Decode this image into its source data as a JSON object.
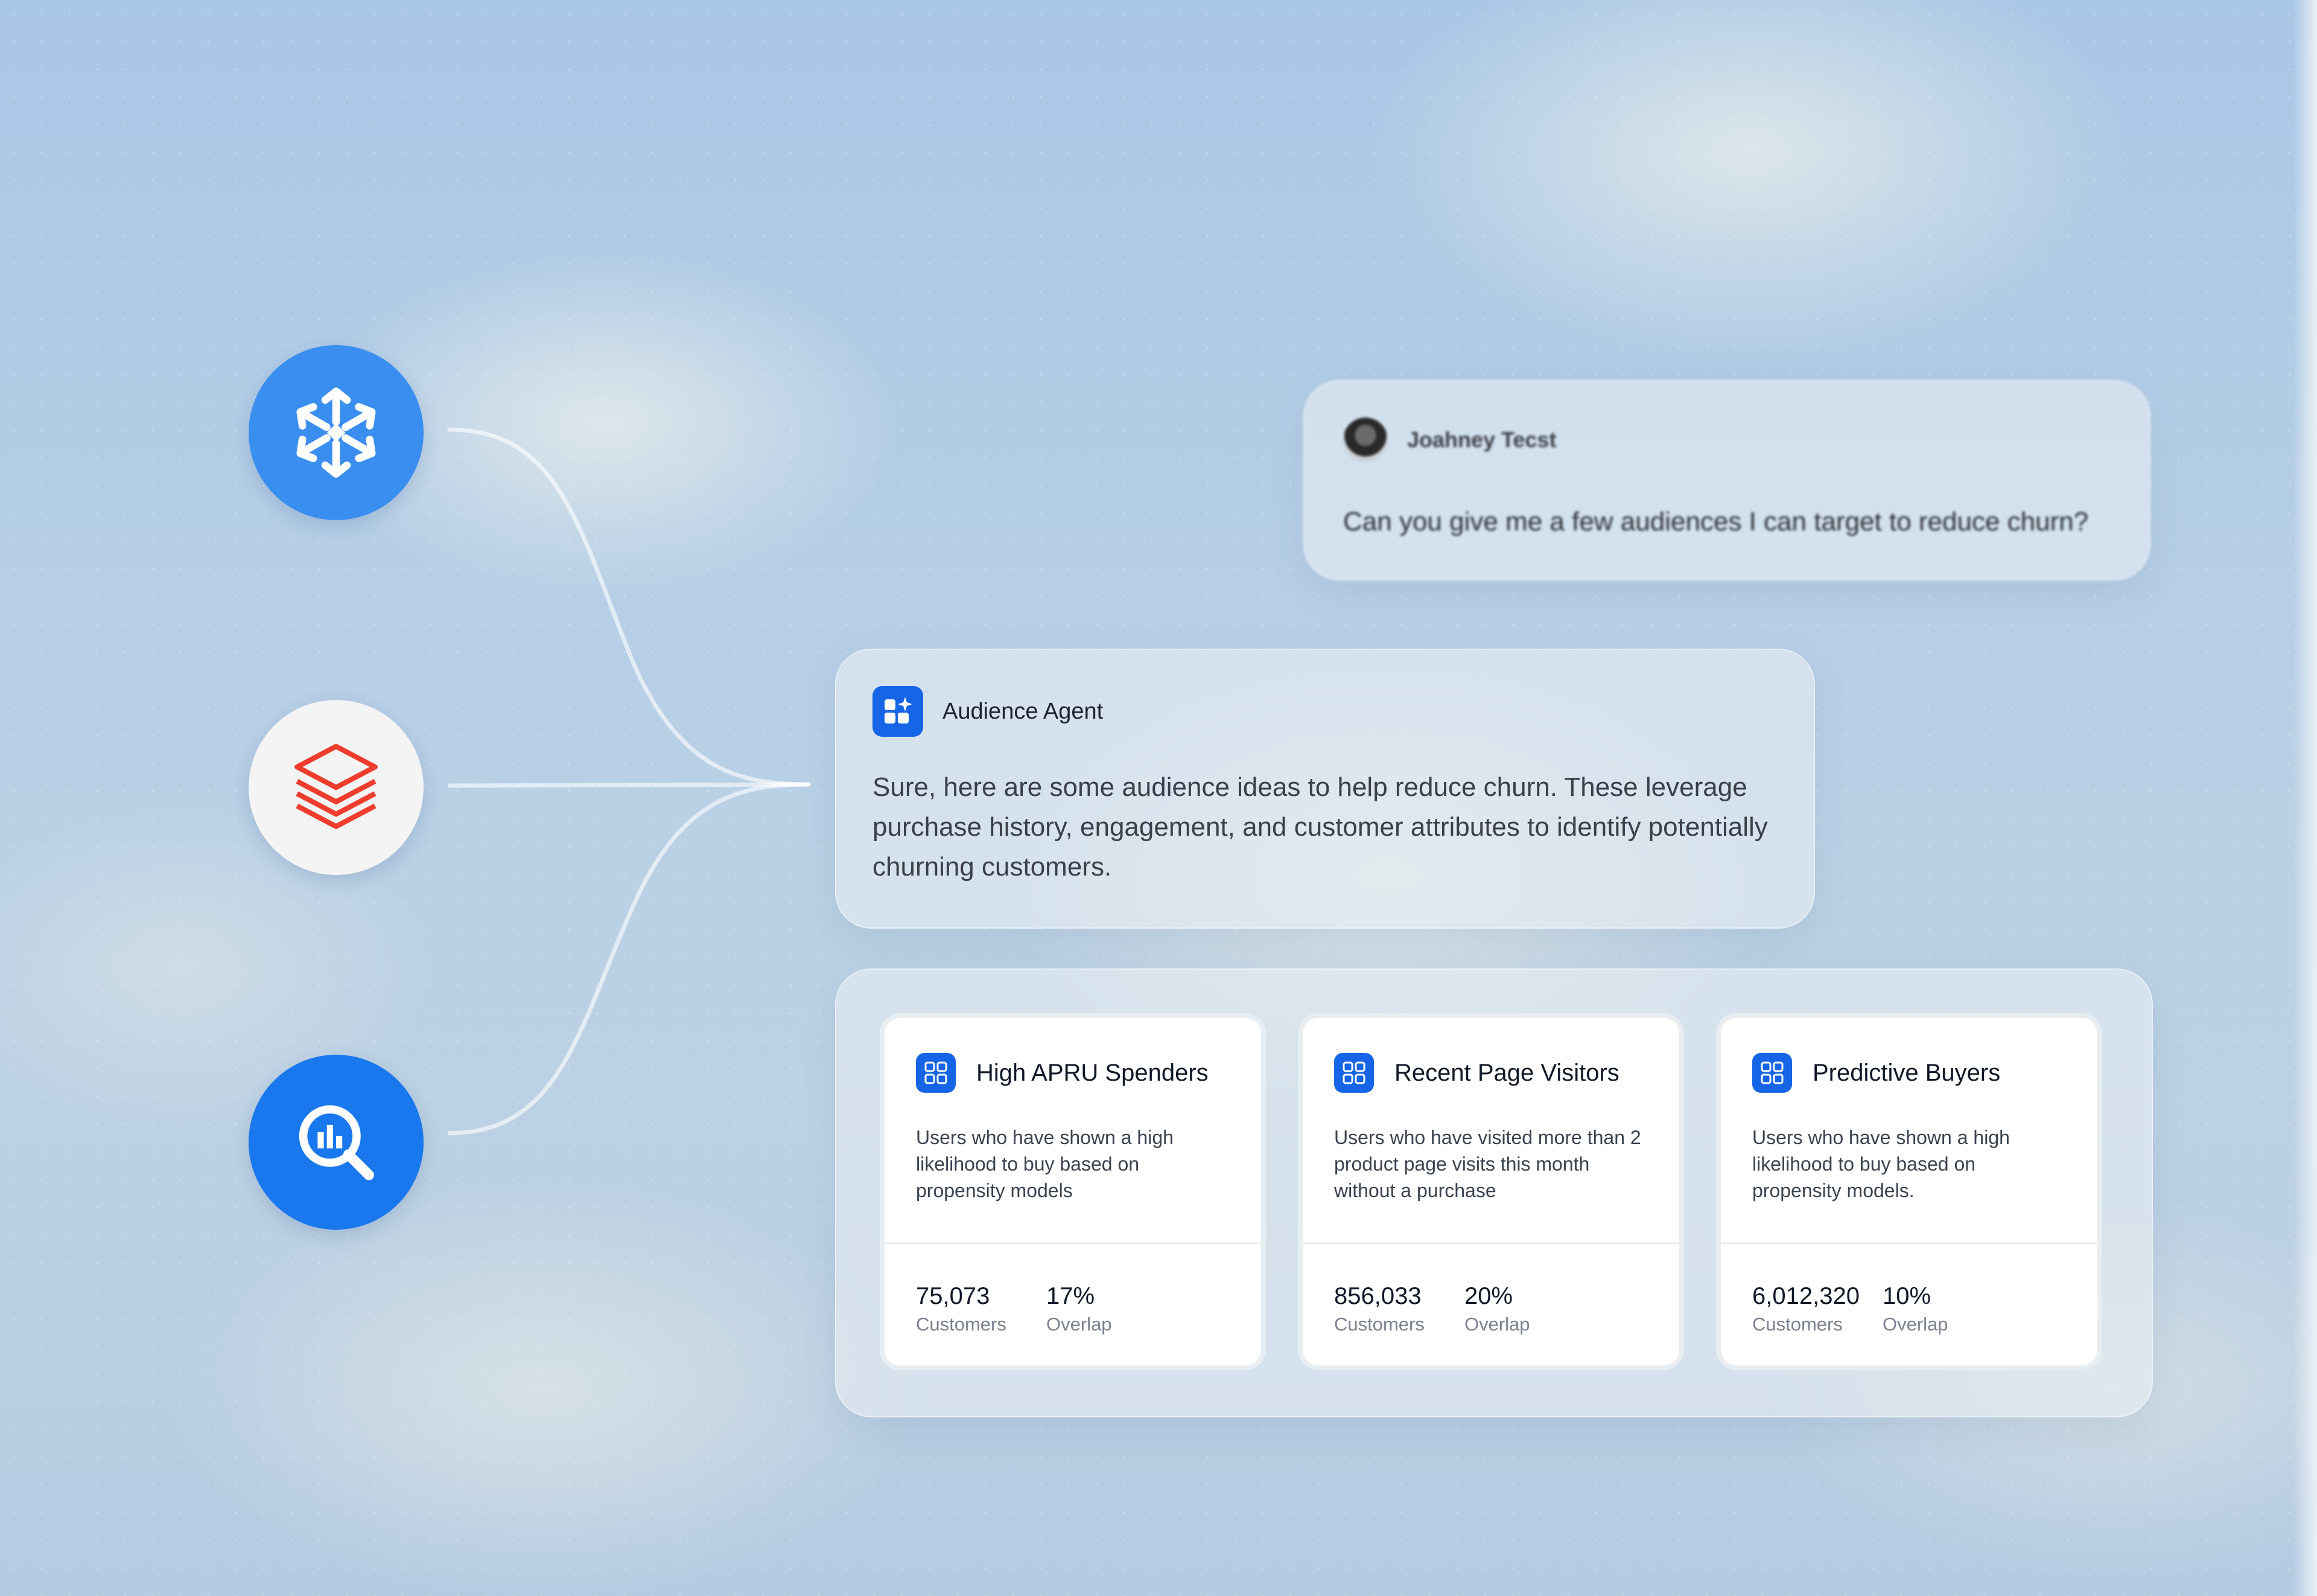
{
  "sources": [
    {
      "name": "Snowflake",
      "icon": "snowflake-icon",
      "color": "#3a8ef0"
    },
    {
      "name": "Databricks",
      "icon": "databricks-icon",
      "color": "#f4f4f4"
    },
    {
      "name": "BigQuery",
      "icon": "bigquery-icon",
      "color": "#1a78ee"
    }
  ],
  "user_message": {
    "name": "Joahney Tecst",
    "text": "Can you give me a few audiences I can target to reduce churn?"
  },
  "agent_message": {
    "name": "Audience Agent",
    "text": "Sure, here are some audience ideas to help reduce churn. These leverage purchase history, engagement, and customer attributes to identify potentially churning customers."
  },
  "audiences": [
    {
      "title": "High APRU Spenders",
      "description": "Users who have shown a high likelihood to buy based on propensity models",
      "customers": "75,073",
      "customers_label": "Customers",
      "overlap": "17%",
      "overlap_label": "Overlap"
    },
    {
      "title": "Recent Page Visitors",
      "description": "Users who have visited more than 2 product page visits this month without a purchase",
      "customers": "856,033",
      "customers_label": "Customers",
      "overlap": "20%",
      "overlap_label": "Overlap"
    },
    {
      "title": "Predictive Buyers",
      "description": "Users who have shown a high likelihood to buy based on propensity models.",
      "customers": "6,012,320",
      "customers_label": "Customers",
      "overlap": "10%",
      "overlap_label": "Overlap"
    }
  ],
  "colors": {
    "accent": "#1565e6",
    "databricks_red": "#ee3d2c"
  }
}
